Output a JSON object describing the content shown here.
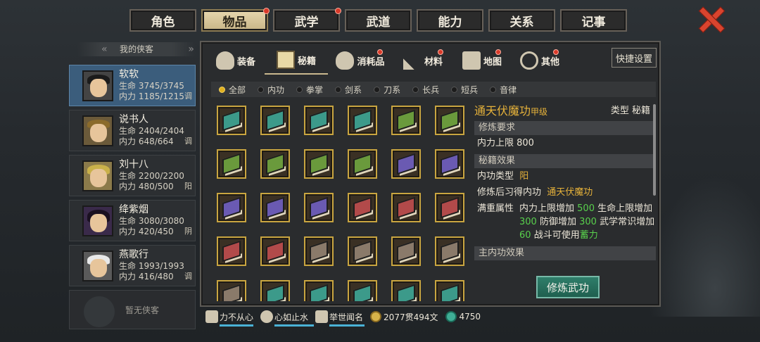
{
  "top_tabs": [
    {
      "label": "角色",
      "active": false,
      "badge": false
    },
    {
      "label": "物品",
      "active": true,
      "badge": true
    },
    {
      "label": "武学",
      "active": false,
      "badge": true
    },
    {
      "label": "武道",
      "active": false,
      "badge": false
    },
    {
      "label": "能力",
      "active": false,
      "badge": false
    },
    {
      "label": "关系",
      "active": false,
      "badge": false
    },
    {
      "label": "记事",
      "active": false,
      "badge": false
    }
  ],
  "left_panel": {
    "header": "我的侠客",
    "characters": [
      {
        "name": "软软",
        "hp": "生命 3745/3745",
        "mp": "内力 1185/1215",
        "tag": "调"
      },
      {
        "name": "说书人",
        "hp": "生命 2404/2404",
        "mp": "内力 648/664",
        "tag": "调"
      },
      {
        "name": "刘十八",
        "hp": "生命 2200/2200",
        "mp": "内力 480/500",
        "tag": "阳"
      },
      {
        "name": "绛紫烟",
        "hp": "生命 3080/3080",
        "mp": "内力 420/450",
        "tag": "阴"
      },
      {
        "name": "燕歌行",
        "hp": "生命 1993/1993",
        "mp": "内力 416/480",
        "tag": "调"
      }
    ],
    "empty_slot": "暂无侠客"
  },
  "categories": [
    {
      "label": "装备",
      "icon": "armor-icon",
      "badge": false
    },
    {
      "label": "秘籍",
      "icon": "book-icon",
      "badge": false
    },
    {
      "label": "消耗品",
      "icon": "potion-icon",
      "badge": true
    },
    {
      "label": "材料",
      "icon": "herb-icon",
      "badge": true
    },
    {
      "label": "地图",
      "icon": "map-icon",
      "badge": true
    },
    {
      "label": "其他",
      "icon": "other-icon",
      "badge": true
    }
  ],
  "shortcut_label": "快捷设置",
  "filters": [
    "全部",
    "内功",
    "拳掌",
    "剑系",
    "刀系",
    "长兵",
    "短兵",
    "音律"
  ],
  "book_colors": [
    "#3c9a8a",
    "#3c9a8a",
    "#3c9a8a",
    "#3c9a8a",
    "#6a9a3c",
    "#6a9a3c",
    "#6a9a3c",
    "#6a9a3c",
    "#6a9a3c",
    "#6a9a3c",
    "#6a5ab2",
    "#6a5ab2",
    "#6a5ab2",
    "#6a5ab2",
    "#6a5ab2",
    "#b24a4a",
    "#b24a4a",
    "#b24a4a",
    "#b24a4a",
    "#b24a4a",
    "#8a7a6a",
    "#8a7a6a",
    "#8a7a6a",
    "#8a7a6a",
    "#8a7a6a",
    "#3c9a8a",
    "#3c9a8a",
    "#3c9a8a",
    "#3c9a8a",
    "#3c9a8a"
  ],
  "detail": {
    "title": "通天伏魔功",
    "grade": "甲级",
    "type": "类型  秘籍",
    "req_header": "修炼要求",
    "req_row": "内力上限  800",
    "effect_header": "秘籍效果",
    "skill_type_label": "内功类型",
    "skill_type_value": "阳",
    "learn_label": "修炼后习得内功",
    "learn_value": "通天伏魔功",
    "full_label": "满重属性",
    "full_parts": [
      "内力上限增加 ",
      "500",
      " 生命上限增加 ",
      "300",
      " 防御增加 ",
      "300",
      " 武学常识增加 ",
      "60",
      " 战斗可使用",
      "蓄力"
    ],
    "main_effect_header": "主内功效果"
  },
  "train_button": "修炼武功",
  "status": {
    "s1": "力不从心",
    "s2": "心如止水",
    "s3": "举世闻名",
    "money": "2077贯494文",
    "jade": "4750"
  }
}
